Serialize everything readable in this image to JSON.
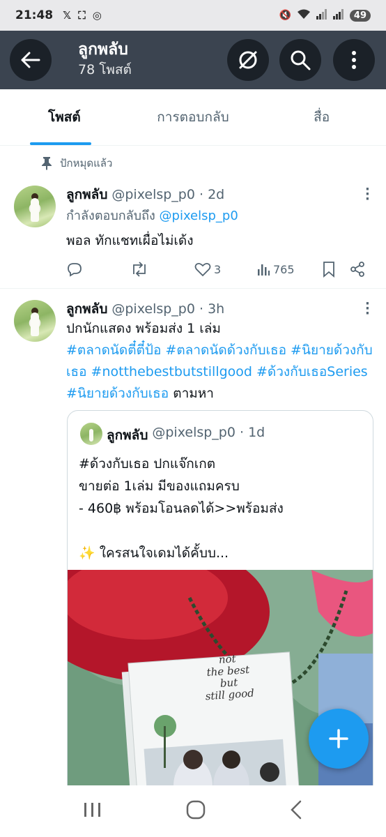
{
  "status_bar": {
    "time": "21:48",
    "battery": "49"
  },
  "header": {
    "title": "ลูกพลับ",
    "subtitle": "78 โพสต์"
  },
  "tabs": [
    {
      "label": "โพสต์",
      "active": true
    },
    {
      "label": "การตอบกลับ",
      "active": false
    },
    {
      "label": "สื่อ",
      "active": false
    }
  ],
  "pinned_label": "ปักหมุดแล้ว",
  "posts": [
    {
      "name": "ลูกพลับ",
      "handle": "@pixelsp_p0 · 2d",
      "reply_prefix": "กำลังตอบกลับถึง ",
      "reply_to": "@pixelsp_p0",
      "text": "พอล ทักแชทเผื่อไม่เด้ง",
      "likes": "3",
      "views": "765"
    },
    {
      "name": "ลูกพลับ",
      "handle": "@pixelsp_p0 · 3h",
      "line1": "ปกนักแสดง พร้อมส่ง 1 เล่ม",
      "tags_a": "#ตลาดนัดตี๋ตี๋ป้อ #ตลาดนัดด้วงกับเธอ #นิยายด้วงกับเธอ #notthebestbutstillgood #ด้วงกับเธอSeries #นิยายด้วงกับเธอ",
      "tail": " ตามหา"
    }
  ],
  "quote": {
    "name": "ลูกพลับ",
    "handle": "@pixelsp_p0 · 1d",
    "text": "#ด้วงกับเธอ ปกแจ๊กเกต\nขายต่อ 1เล่ม มีของแถมครบ\n- 460฿  พร้อมโอนลดได้>>พร้อมส่ง\n\n✨ ใครสนใจเดมได้คั้บบ...",
    "book_title_lines": [
      "not",
      "the best",
      "but",
      "still good"
    ]
  },
  "colors": {
    "accent": "#1d9bf0",
    "header_bg": "#3b4450",
    "muted": "#536471"
  }
}
